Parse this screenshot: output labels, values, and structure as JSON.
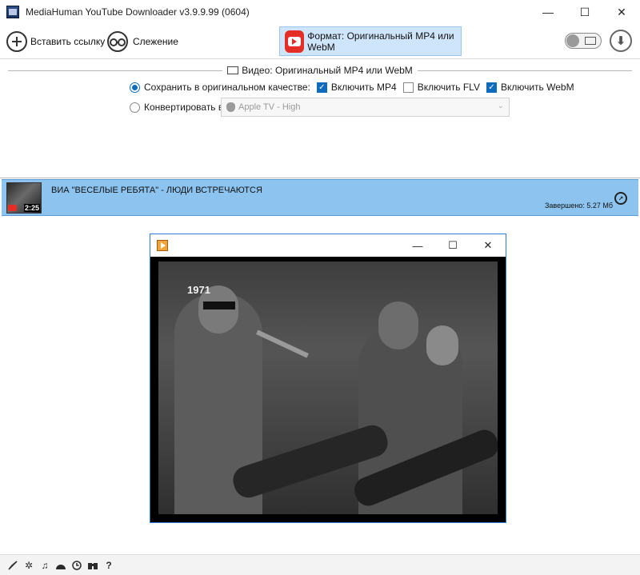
{
  "window": {
    "title": "MediaHuman YouTube Downloader v3.9.9.99 (0604)",
    "minimize": "—",
    "maximize": "☐",
    "close": "✕"
  },
  "toolbar": {
    "paste_label": "Вставить ссылку",
    "tracking_label": "Слежение",
    "format_label": "Формат: Оригинальный MP4 или WebM",
    "download_icon": "⬇"
  },
  "options": {
    "section_title": "Видео: Оригинальный MP4 или WebM",
    "keep_original_label": "Сохранить в оригинальном качестве:",
    "keep_original_selected": true,
    "include_mp4_label": "Включить MP4",
    "include_mp4": true,
    "include_flv_label": "Включить FLV",
    "include_flv": false,
    "include_webm_label": "Включить WebM",
    "include_webm": true,
    "convert_label": "Конвертировать в:",
    "convert_selected": false,
    "convert_value": "Apple TV - High"
  },
  "download_item": {
    "title": "ВИА \"ВЕСЕЛЫЕ РЕБЯТА\" - ЛЮДИ ВСТРЕЧАЮТСЯ",
    "duration": "2:25",
    "status": "Завершено: 5.27 Мб"
  },
  "player": {
    "minimize": "—",
    "maximize": "☐",
    "close": "✕",
    "overlay_text": "1971"
  },
  "bottom_bar": {
    "icons": [
      "feedback-icon",
      "settings-icon",
      "music-icon",
      "speed-icon",
      "history-icon",
      "binoculars-icon",
      "help-icon"
    ],
    "help_label": "?"
  },
  "colors": {
    "accent": "#0f6cbd",
    "selected_item_bg": "#8cc4ef",
    "format_button_bg": "#cfe5fb",
    "youtube_red": "#e52d27",
    "player_border": "#2a7ad6"
  }
}
